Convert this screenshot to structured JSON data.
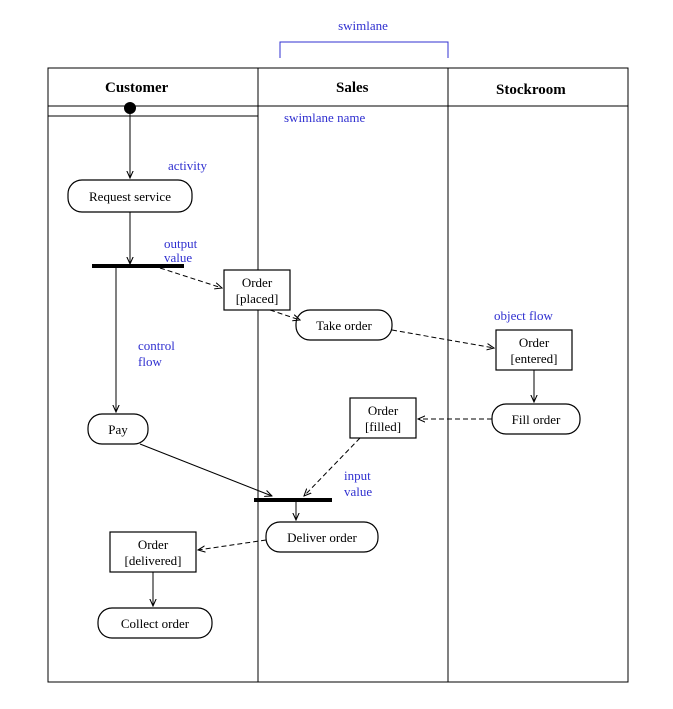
{
  "diagram": {
    "lanes": {
      "customer": "Customer",
      "sales": "Sales",
      "stockroom": "Stockroom"
    },
    "activities": {
      "request_service": "Request service",
      "take_order": "Take order",
      "fill_order": "Fill order",
      "pay": "Pay",
      "deliver_order": "Deliver order",
      "collect_order": "Collect order"
    },
    "objects": {
      "order_placed_l1": "Order",
      "order_placed_l2": "[placed]",
      "order_entered_l1": "Order",
      "order_entered_l2": "[entered]",
      "order_filled_l1": "Order",
      "order_filled_l2": "[filled]",
      "order_delivered_l1": "Order",
      "order_delivered_l2": "[delivered]"
    },
    "annotations": {
      "swimlane": "swimlane",
      "swimlane_name": "swimlane name",
      "activity": "activity",
      "output_value_l1": "output",
      "output_value_l2": "value",
      "control_flow_l1": "control",
      "control_flow_l2": "flow",
      "object_flow": "object flow",
      "input_value_l1": "input",
      "input_value_l2": "value"
    }
  }
}
